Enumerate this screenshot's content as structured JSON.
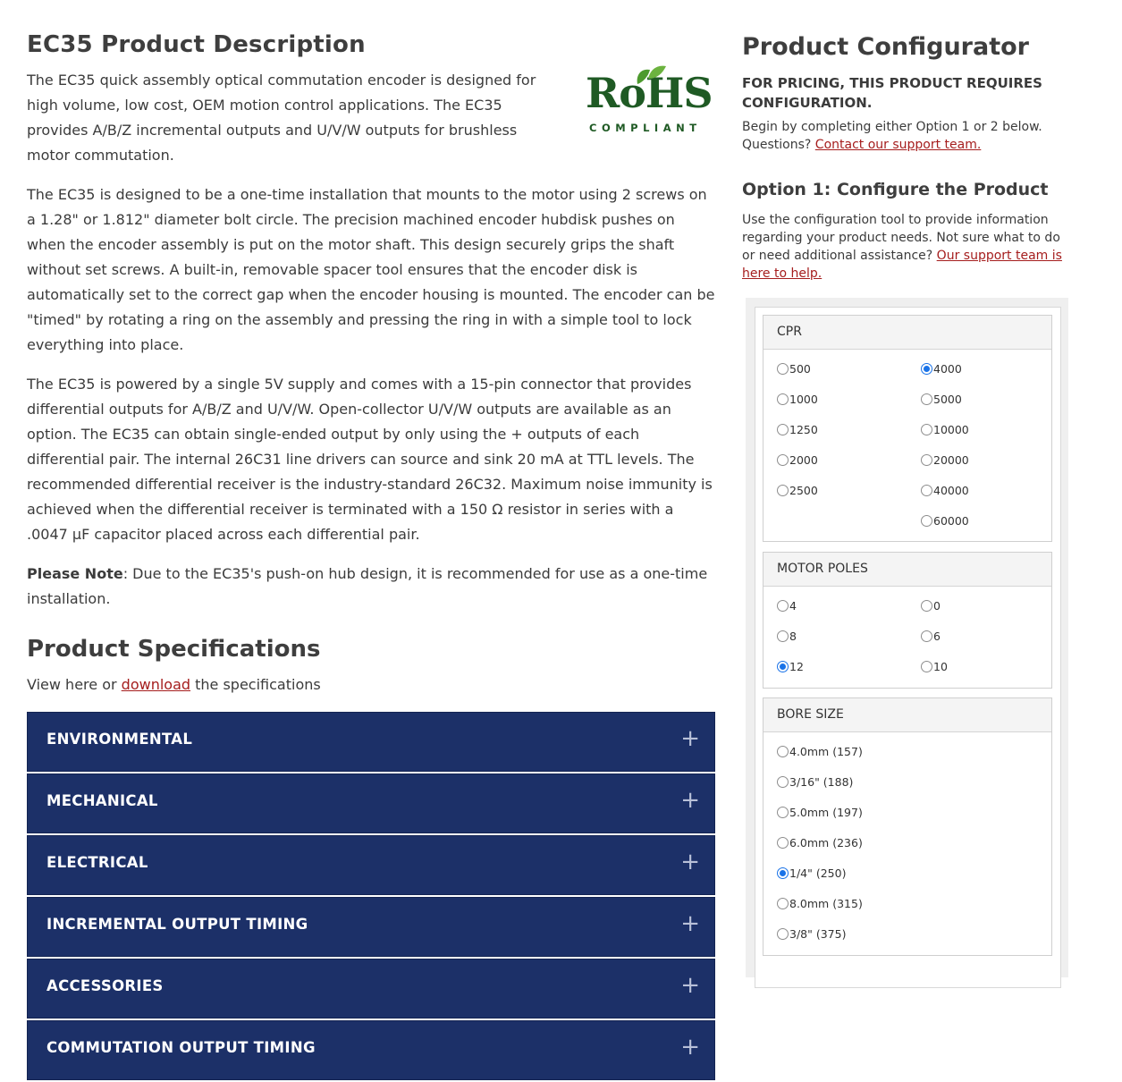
{
  "description": {
    "title": "EC35 Product Description",
    "p1": "The EC35 quick assembly optical commutation encoder is designed for high volume, low cost, OEM motion control applications. The EC35 provides A/B/Z incremental outputs and U/V/W outputs for brushless motor commutation.",
    "p2": "The EC35 is designed to be a one-time installation that mounts to the motor using 2 screws on a 1.28\" or 1.812\" diameter bolt circle. The precision machined encoder hubdisk pushes on when the encoder assembly is put on the motor shaft. This design securely grips the shaft without set screws. A built-in, removable spacer tool ensures that the encoder disk is automatically set to the correct gap when the encoder housing is mounted. The encoder can be \"timed\" by rotating a ring on the assembly and pressing the ring in with a simple tool to lock everything into place.",
    "p3": "The EC35 is powered by a single 5V supply and comes with a 15-pin connector that provides differential outputs for A/B/Z and U/V/W. Open-collector U/V/W outputs are available as an option. The EC35 can obtain single-ended output by only using the + outputs of each differential pair. The internal 26C31 line drivers can source and sink 20 mA at TTL levels. The recommended differential receiver is the industry-standard 26C32. Maximum noise immunity is achieved when the differential receiver is terminated with a 150 Ω resistor in series with a .0047 µF capacitor placed across each differential pair.",
    "note_label": "Please Note",
    "note_text": ": Due to the EC35's push-on hub design, it is recommended for use as a one-time installation."
  },
  "rohs": {
    "main": "RoHS",
    "sub": "COMPLIANT",
    "color": "#1f5a24"
  },
  "specs": {
    "title": "Product Specifications",
    "prefix": "View here or ",
    "link": "download",
    "suffix": " the specifications",
    "sections": [
      "ENVIRONMENTAL",
      "MECHANICAL",
      "ELECTRICAL",
      "INCREMENTAL OUTPUT TIMING",
      "ACCESSORIES",
      "COMMUTATION OUTPUT TIMING"
    ],
    "expand_icon": "+",
    "accent": "#1c3068"
  },
  "configurator": {
    "title": "Product Configurator",
    "requirement": "FOR PRICING, THIS PRODUCT REQUIRES CONFIGURATION.",
    "intro": "Begin by completing either Option 1 or 2 below.",
    "questions": "Questions? ",
    "support_link": "Contact our support team.",
    "option1_title": "Option 1: Configure the Product",
    "option1_text": "Use the configuration tool to provide information regarding your product needs. Not sure what to do or need additional assistance? ",
    "option1_link": "Our support team is here to help.",
    "cpr": {
      "label": "CPR",
      "left": [
        "500",
        "1000",
        "1250",
        "2000",
        "2500"
      ],
      "right": [
        "4000",
        "5000",
        "10000",
        "20000",
        "40000",
        "60000"
      ],
      "selected": "4000"
    },
    "motor_poles": {
      "label": "MOTOR POLES",
      "left": [
        "4",
        "8",
        "12"
      ],
      "right": [
        "0",
        "6",
        "10"
      ],
      "selected": "12"
    },
    "bore_size": {
      "label": "BORE SIZE",
      "options": [
        "4.0mm (157)",
        "3/16\" (188)",
        "5.0mm (197)",
        "6.0mm (236)",
        "1/4\" (250)",
        "8.0mm (315)",
        "3/8\" (375)"
      ],
      "selected": "1/4\" (250)"
    }
  }
}
